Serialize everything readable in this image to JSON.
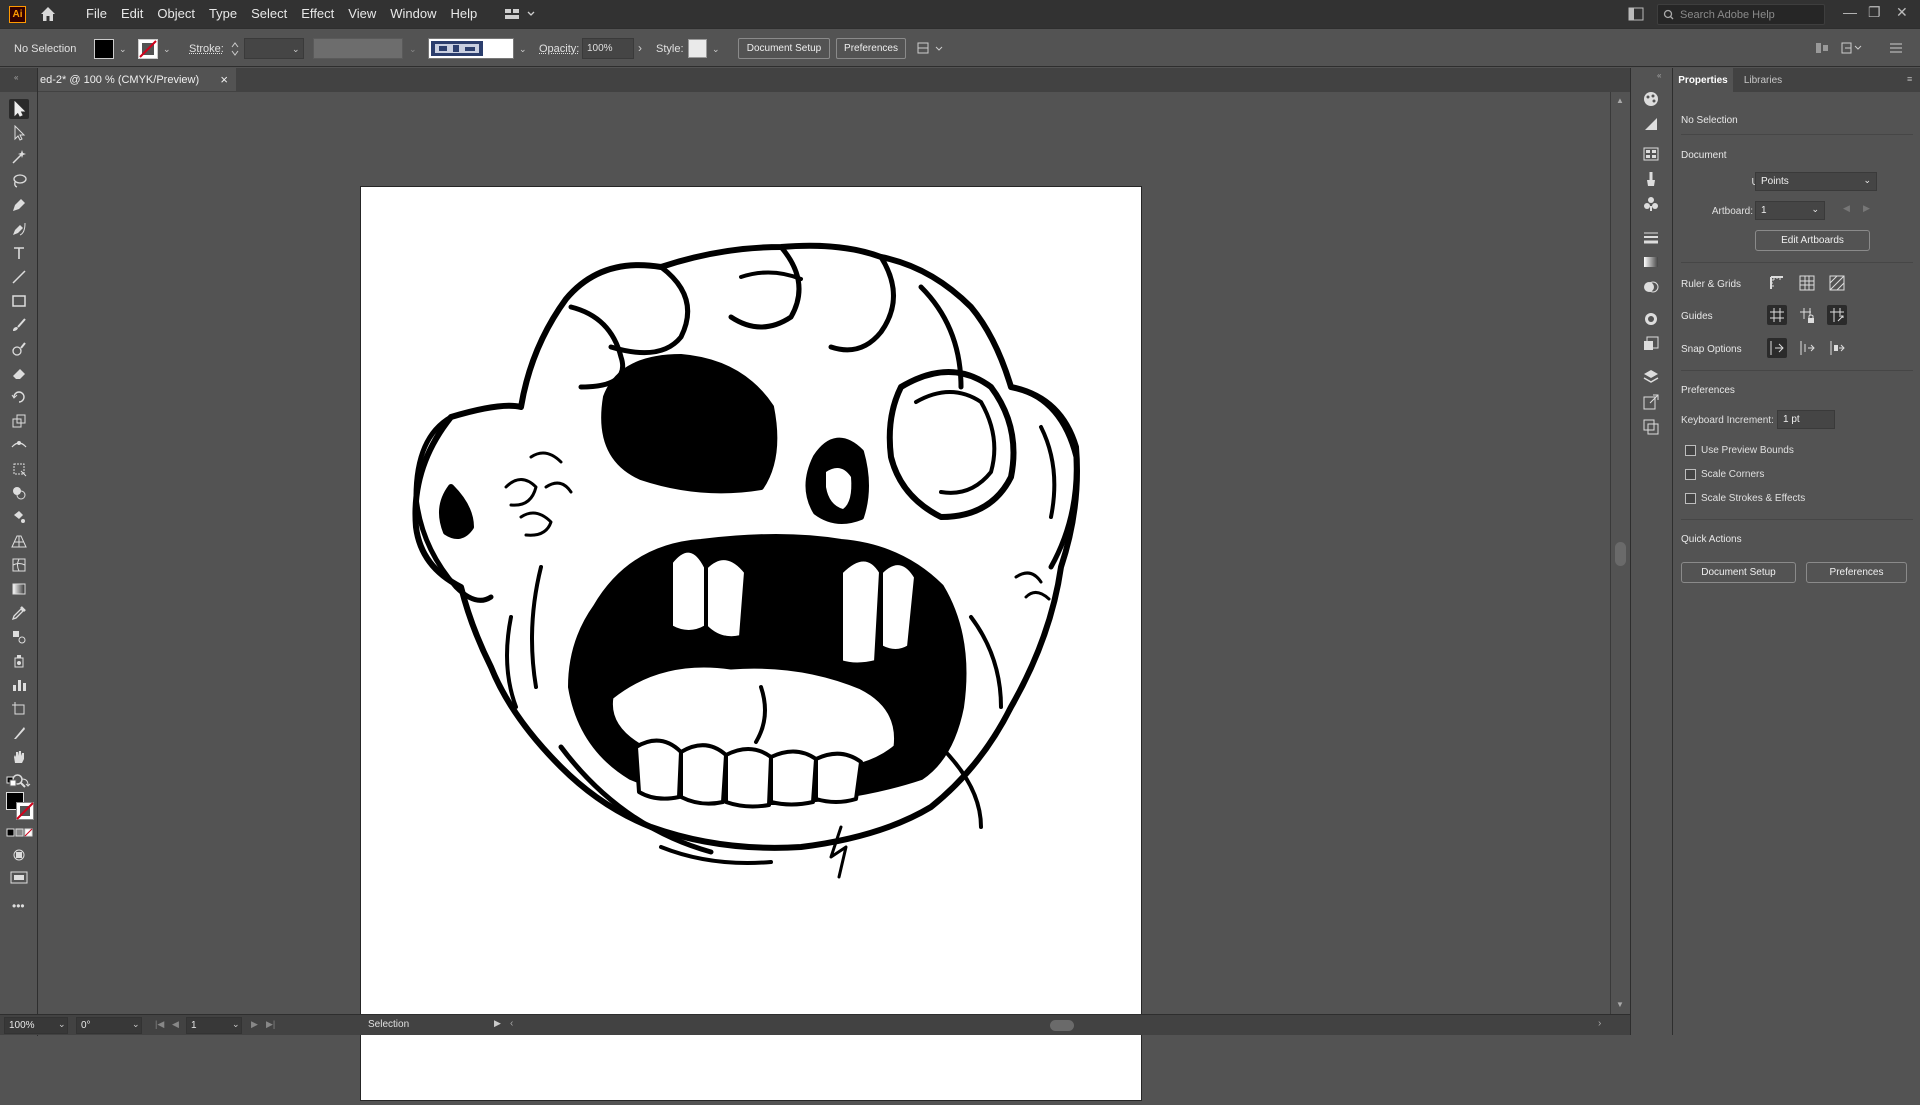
{
  "app": {
    "logo_text": "Ai",
    "menus": [
      "File",
      "Edit",
      "Object",
      "Type",
      "Select",
      "Effect",
      "View",
      "Window",
      "Help"
    ],
    "search_placeholder": "Search Adobe Help"
  },
  "control_bar": {
    "selection_status": "No Selection",
    "stroke_label": "Stroke:",
    "opacity_label": "Opacity:",
    "opacity_value": "100%",
    "style_label": "Style:",
    "document_setup_button": "Document Setup",
    "preferences_button": "Preferences"
  },
  "document_tab": {
    "title": "ed-2* @ 100 % (CMYK/Preview)",
    "close_symbol": "×"
  },
  "status_bar": {
    "zoom": "100%",
    "rotation": "0°",
    "artboard_number": "1",
    "current_tool": "Selection"
  },
  "properties_panel": {
    "tabs": [
      "Properties",
      "Libraries"
    ],
    "selection_status": "No Selection",
    "document_heading": "Document",
    "units_label": "Units:",
    "units_value": "Points",
    "artboard_label": "Artboard:",
    "artboard_value": "1",
    "edit_artboards_button": "Edit Artboards",
    "ruler_grids_label": "Ruler & Grids",
    "guides_label": "Guides",
    "snap_options_label": "Snap Options",
    "preferences_heading": "Preferences",
    "keyboard_increment_label": "Keyboard Increment:",
    "keyboard_increment_value": "1 pt",
    "checkboxes": [
      {
        "label": "Use Preview Bounds",
        "checked": false
      },
      {
        "label": "Scale Corners",
        "checked": false
      },
      {
        "label": "Scale Strokes & Effects",
        "checked": false
      }
    ],
    "quick_actions_heading": "Quick Actions",
    "document_setup_button": "Document Setup",
    "preferences_button": "Preferences"
  },
  "colors": {
    "ui_dark": "#323232",
    "ui_mid": "#535353",
    "ui_panel_tab": "#424242",
    "logo_orange": "#ff9a00",
    "artboard": "#ffffff"
  },
  "toolbar_tools": [
    "selection-tool",
    "direct-selection-tool",
    "magic-wand-tool",
    "lasso-tool",
    "pen-tool",
    "curvature-tool",
    "type-tool",
    "line-segment-tool",
    "rectangle-tool",
    "paintbrush-tool",
    "shaper-tool",
    "eraser-tool",
    "rotate-tool",
    "scale-tool",
    "width-tool",
    "free-transform-tool",
    "shape-builder-tool",
    "live-paint-tool",
    "perspective-grid-tool",
    "mesh-tool",
    "gradient-tool",
    "eyedropper-tool",
    "blend-tool",
    "symbol-sprayer-tool",
    "column-graph-tool",
    "artboard-tool",
    "slice-tool",
    "hand-tool",
    "zoom-tool"
  ]
}
